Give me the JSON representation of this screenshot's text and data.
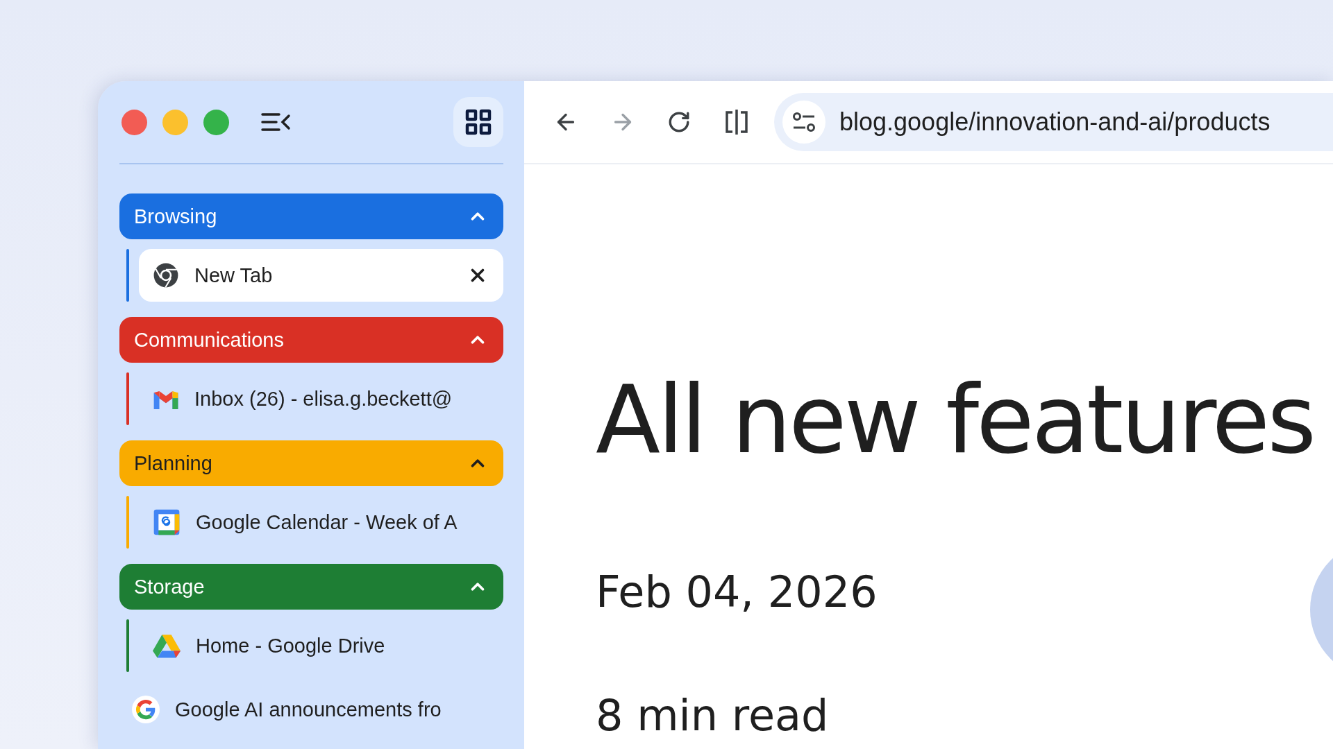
{
  "sidebar": {
    "groups": [
      {
        "name": "Browsing",
        "color": "#1a6fe0",
        "expanded": true,
        "tabs": [
          {
            "title": "New Tab",
            "kind": "chrome",
            "selected": true
          }
        ]
      },
      {
        "name": "Communications",
        "color": "#d93025",
        "expanded": true,
        "tabs": [
          {
            "title": "Inbox (26) - elisa.g.beckett@",
            "kind": "gmail",
            "selected": false
          }
        ]
      },
      {
        "name": "Planning",
        "color": "#f9ab00",
        "expanded": true,
        "tabs": [
          {
            "title": "Google Calendar - Week of A",
            "kind": "calendar",
            "selected": false
          }
        ]
      },
      {
        "name": "Storage",
        "color": "#1e7e34",
        "expanded": true,
        "tabs": [
          {
            "title": "Home - Google Drive",
            "kind": "drive",
            "selected": false
          }
        ]
      }
    ],
    "ungrouped_tabs": [
      {
        "title": "Google AI announcements fro",
        "kind": "google",
        "selected": false
      }
    ]
  },
  "toolbar": {
    "back_disabled": false,
    "forward_disabled": true,
    "address": "blog.google/innovation-and-ai/products"
  },
  "article": {
    "title": "All new features",
    "date": "Feb 04, 2026",
    "read_time": "8 min read"
  }
}
